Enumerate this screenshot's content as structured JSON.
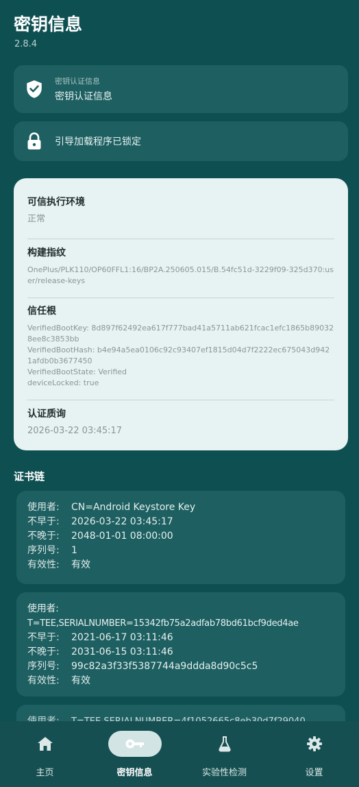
{
  "header": {
    "title": "密钥信息",
    "version": "2.8.4"
  },
  "attestation_card": {
    "label": "密钥认证信息",
    "value": "密钥认证信息"
  },
  "bootloader_card": {
    "text": "引导加载程序已锁定"
  },
  "details": {
    "tee": {
      "title": "可信执行环境",
      "value": "正常"
    },
    "fingerprint": {
      "title": "构建指纹",
      "value": "OnePlus/PLK110/OP60FFL1:16/BP2A.250605.015/B.54fc51d-3229f09-325d370:user/release-keys"
    },
    "root_of_trust": {
      "title": "信任根",
      "lines": [
        "VerifiedBootKey: 8d897f62492ea617f777bad41a5711ab621fcac1efc1865b890328ee8c3853bb",
        "VerifiedBootHash: b4e94a5ea0106c92c93407ef1815d04d7f2222ec675043d9421afdb0b3677450",
        "VerifiedBootState: Verified",
        "deviceLocked: true"
      ]
    },
    "challenge": {
      "title": "认证质询",
      "value": "2026-03-22 03:45:17"
    }
  },
  "chain": {
    "title": "证书链",
    "certs": [
      {
        "subject_label": "使用者:",
        "subject": "CN=Android Keystore Key",
        "not_before_label": "不早于:",
        "not_before": "2026-03-22 03:45:17",
        "not_after_label": "不晚于:",
        "not_after": "2048-01-01 08:00:00",
        "serial_label": "序列号:",
        "serial": "1",
        "validity_label": "有效性:",
        "validity": "有效"
      },
      {
        "subject_label": "使用者:",
        "subject": "T=TEE,SERIALNUMBER=15342fb75a2adfab78bd61bcf9ded4ae",
        "not_before_label": "不早于:",
        "not_before": "2021-06-17 03:11:46",
        "not_after_label": "不晚于:",
        "not_after": "2031-06-15 03:11:46",
        "serial_label": "序列号:",
        "serial": "99c82a3f33f5387744a9ddda8d90c5c5",
        "validity_label": "有效性:",
        "validity": "有效"
      }
    ],
    "partial": {
      "subject_label": "使用者:",
      "subject": "T=TEE,SERIALNUMBER=4f1052665c8eb30d7f29040"
    }
  },
  "nav": {
    "items": [
      {
        "label": "主页",
        "icon": "home-icon"
      },
      {
        "label": "密钥信息",
        "icon": "key-icon"
      },
      {
        "label": "实验性检测",
        "icon": "flask-icon"
      },
      {
        "label": "设置",
        "icon": "gear-icon"
      }
    ]
  }
}
